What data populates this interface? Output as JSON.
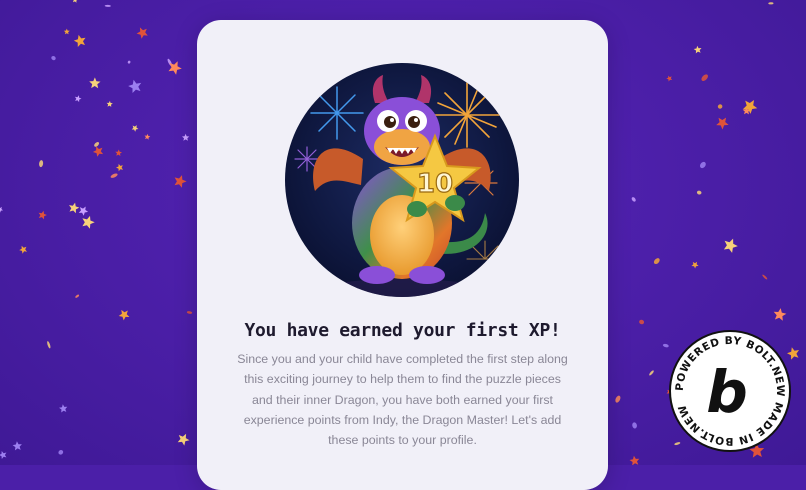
{
  "modal": {
    "title": "You have earned your first XP!",
    "body": "Since you and your child have completed the first step along this exciting journey to help them to find the puzzle pieces and their inner Dragon, you have both earned your first experience points from Indy, the Dragon Master! Let's add these points to your profile."
  },
  "hero": {
    "star_badge_value": "10",
    "icon": "dragon-holding-star-illustration"
  },
  "badge": {
    "text": "POWERED BY BOLT.NEW  MADE IN BOLT.NEW ",
    "letter": "b"
  },
  "colors": {
    "background": "#4b1fa8",
    "card": "#f1f0f8",
    "title": "#1e1a2e",
    "body_text": "#8a8796",
    "star_gold": "#f5c842"
  }
}
